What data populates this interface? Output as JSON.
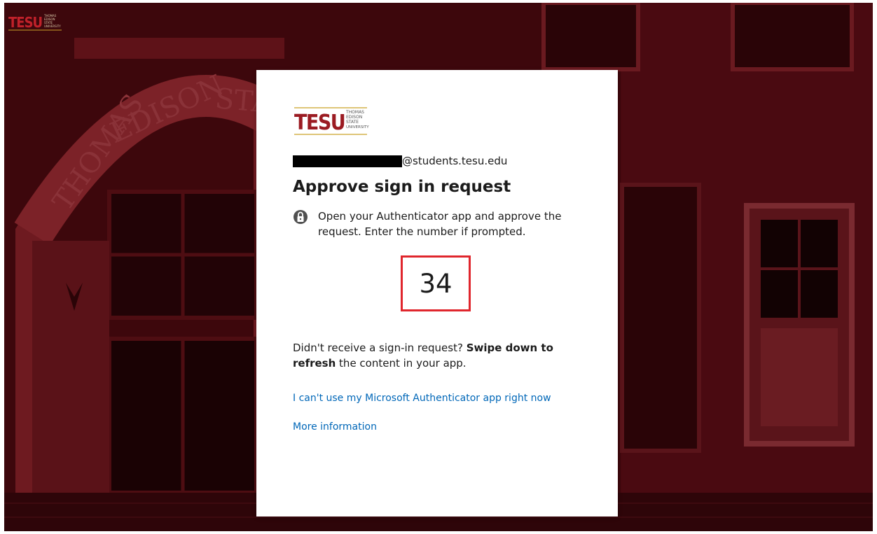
{
  "brand": {
    "logo_text": "TESU",
    "logo_subtext": [
      "THOMAS",
      "EDISON",
      "STATE",
      "UNIVERSITY"
    ],
    "accent_color": "#9b1b22",
    "gold_color": "#c9a227"
  },
  "background": {
    "arch_text": "THOMAS EDISON STATE"
  },
  "signin": {
    "identity_suffix": "@students.tesu.edu",
    "title": "Approve sign in request",
    "instruction": "Open your Authenticator app and approve the request. Enter the number if prompted.",
    "number": "34",
    "no_request_prefix": "Didn't receive a sign-in request? ",
    "no_request_bold": "Swipe down to refresh",
    "no_request_suffix": " the content in your app.",
    "link_cant_use": "I can't use my Microsoft Authenticator app right now",
    "link_more_info": "More information"
  },
  "colors": {
    "link": "#0067b8",
    "number_border": "#e0262d"
  },
  "icons": {
    "authenticator": "authenticator-lock-icon"
  }
}
